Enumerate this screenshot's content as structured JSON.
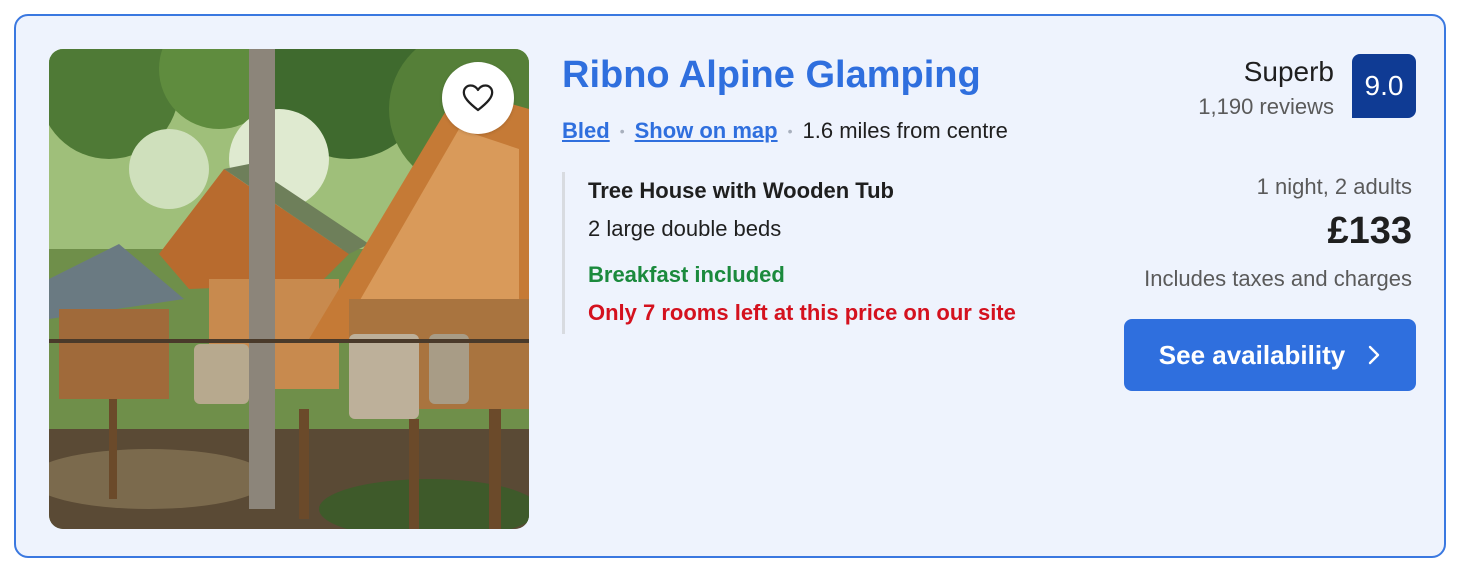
{
  "property": {
    "name": "Ribno Alpine Glamping",
    "favorite_icon": "heart-outline-icon",
    "location": {
      "town": "Bled",
      "map_link": "Show on map",
      "distance": "1.6 miles from centre"
    },
    "room": {
      "name": "Tree House with Wooden Tub",
      "beds": "2 large double beds",
      "breakfast": "Breakfast included",
      "scarcity": "Only 7 rooms left at this price on our site"
    },
    "review": {
      "word": "Superb",
      "count": "1,190 reviews",
      "score": "9.0"
    },
    "pricing": {
      "stay": "1 night, 2 adults",
      "price": "£133",
      "taxes": "Includes taxes and charges"
    },
    "cta": {
      "label": "See availability",
      "icon": "chevron-right-icon"
    },
    "colors": {
      "accent": "#2f6fde",
      "score_badge": "#0f3b94",
      "success": "#1b8a3d",
      "urgent": "#d4111e",
      "card_bg": "#eef3fd"
    }
  }
}
